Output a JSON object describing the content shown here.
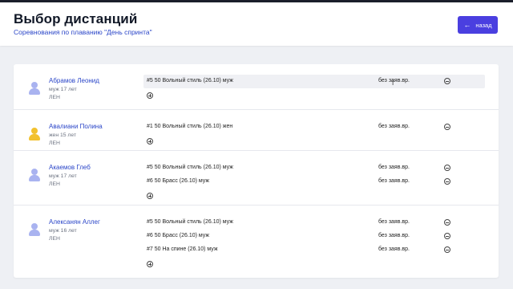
{
  "header": {
    "title": "Выбор дистанций",
    "subtitle": "Соревнования по плаванию \"День спринта\"",
    "back_label": "назад"
  },
  "colors": {
    "accent": "#4a3fe0",
    "link": "#2b46c8",
    "avatar_male": "#a9b3f0",
    "avatar_female": "#f2c12e"
  },
  "athletes": [
    {
      "name": "Абрамов Леонид",
      "meta": "муж 17 лет",
      "club": "ЛЕН",
      "avatar": "male",
      "events": [
        {
          "name": "#5 50 Вольный стиль (26.10) муж",
          "status": "без заяв.вр."
        }
      ]
    },
    {
      "name": "Авалиани Полина",
      "meta": "жен 15 лет",
      "club": "ЛЕН",
      "avatar": "female",
      "events": [
        {
          "name": "#1 50 Вольный стиль (26.10) жен",
          "status": "без заяв.вр."
        }
      ]
    },
    {
      "name": "Акаемов Глеб",
      "meta": "муж 17 лет",
      "club": "ЛЕН",
      "avatar": "male",
      "events": [
        {
          "name": "#5 50 Вольный стиль (26.10) муж",
          "status": "без заяв.вр."
        },
        {
          "name": "#6 50 Брасс (26.10) муж",
          "status": "без заяв.вр."
        }
      ]
    },
    {
      "name": "Алексанян Аллег",
      "meta": "муж 16 лет",
      "club": "ЛЕН",
      "avatar": "male",
      "events": [
        {
          "name": "#5 50 Вольный стиль (26.10) муж",
          "status": "без заяв.вр."
        },
        {
          "name": "#6 50 Брасс (26.10) муж",
          "status": "без заяв.вр."
        },
        {
          "name": "#7 50 На спине (26.10) муж",
          "status": "без заяв.вр."
        }
      ]
    }
  ]
}
